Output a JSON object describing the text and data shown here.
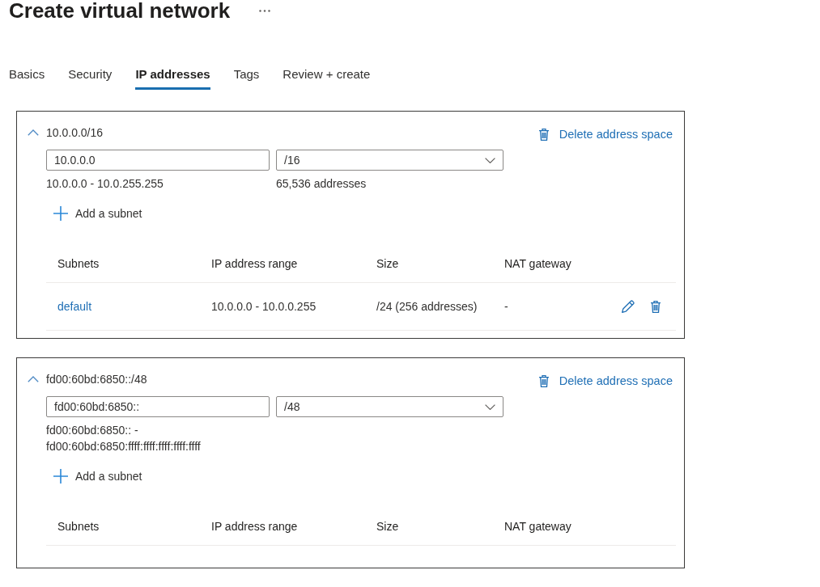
{
  "title": "Create virtual network",
  "tabs": [
    {
      "label": "Basics",
      "selected": false
    },
    {
      "label": "Security",
      "selected": false
    },
    {
      "label": "IP addresses",
      "selected": true
    },
    {
      "label": "Tags",
      "selected": false
    },
    {
      "label": "Review + create",
      "selected": false
    }
  ],
  "address_spaces": [
    {
      "title": "10.0.0.0/16",
      "expanded": true,
      "delete_label": "Delete address space",
      "address": "10.0.0.0",
      "prefix": "/16",
      "range": "10.0.0.0 - 10.0.255.255",
      "address_count": "65,536 addresses",
      "add_subnet_label": "Add a subnet",
      "columns": [
        "Subnets",
        "IP address range",
        "Size",
        "NAT gateway"
      ],
      "subnets": [
        {
          "name": "default",
          "range": "10.0.0.0 - 10.0.0.255",
          "size": "/24 (256 addresses)",
          "nat_gateway": "-"
        }
      ]
    },
    {
      "title": "fd00:60bd:6850::/48",
      "expanded": true,
      "delete_label": "Delete address space",
      "address": "fd00:60bd:6850::",
      "prefix": "/48",
      "range": "fd00:60bd:6850:: - fd00:60bd:6850:ffff:ffff:ffff:ffff:ffff",
      "add_subnet_label": "Add a subnet",
      "columns": [
        "Subnets",
        "IP address range",
        "Size",
        "NAT gateway"
      ]
    }
  ]
}
